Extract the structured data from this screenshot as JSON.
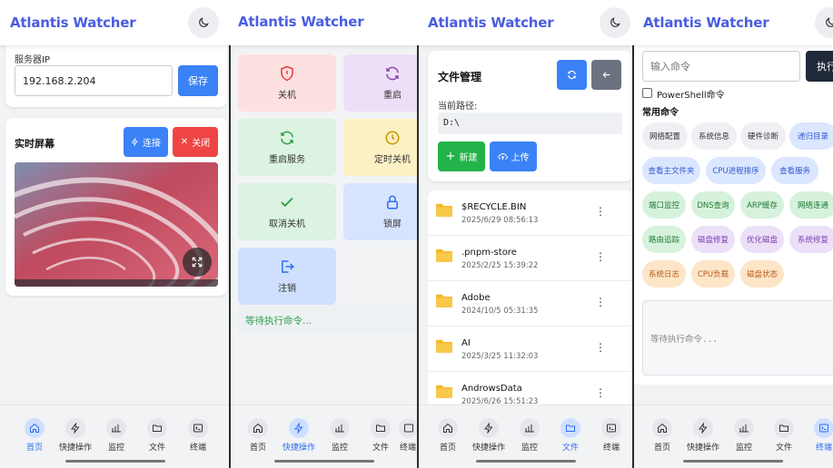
{
  "app_title": "Atlantis Watcher",
  "nav": [
    {
      "label": "首页",
      "icon": "home-icon"
    },
    {
      "label": "快捷操作",
      "icon": "bolt-icon"
    },
    {
      "label": "监控",
      "icon": "chart-icon"
    },
    {
      "label": "文件",
      "icon": "folder-icon"
    },
    {
      "label": "终端",
      "icon": "terminal-icon"
    }
  ],
  "home": {
    "server_ip_label": "服务器IP",
    "server_ip_value": "192.168.2.204",
    "save_label": "保存",
    "realtime_title": "实时屏幕",
    "connect_label": "连接",
    "close_label": "关闭"
  },
  "quick": {
    "tiles": [
      {
        "label": "关机",
        "icon": "shield-alert-icon",
        "color": "#e53935"
      },
      {
        "label": "重启",
        "icon": "refresh-icon",
        "color": "#8e44ad"
      },
      {
        "label": "重启服务",
        "icon": "refresh-icon",
        "color": "#2e9e4e"
      },
      {
        "label": "定时关机",
        "icon": "clock-icon",
        "color": "#c69500"
      },
      {
        "label": "取消关机",
        "icon": "check-icon",
        "color": "#2e9e4e"
      },
      {
        "label": "锁屏",
        "icon": "lock-icon",
        "color": "#2f6df0"
      },
      {
        "label": "注销",
        "icon": "logout-icon",
        "color": "#2f6df0"
      }
    ],
    "status": "等待执行命令..."
  },
  "files": {
    "title": "文件管理",
    "path_label": "当前路径:",
    "path_value": "D:\\",
    "new_label": "新建",
    "upload_label": "上传",
    "items": [
      {
        "name": "$RECYCLE.BIN",
        "date": "2025/6/29 08:56:13"
      },
      {
        "name": ".pnpm-store",
        "date": "2025/2/25 15:39:22"
      },
      {
        "name": "Adobe",
        "date": "2024/10/5 05:31:35"
      },
      {
        "name": "AI",
        "date": "2025/3/25 11:32:03"
      },
      {
        "name": "AndrowsData",
        "date": "2025/6/26 15:51:23"
      }
    ]
  },
  "terminal": {
    "input_placeholder": "输入命令",
    "exec_label": "执行",
    "powershell_label": "PowerShell命令",
    "common_title": "常用命令",
    "output_placeholder": "等待执行命令...",
    "commands": [
      {
        "label": "网络配置",
        "style": "g"
      },
      {
        "label": "系统信息",
        "style": "g"
      },
      {
        "label": "硬件诊断",
        "style": "g"
      },
      {
        "label": "递归目录",
        "style": "b"
      },
      {
        "label": "查看主文件夹",
        "style": "b"
      },
      {
        "label": "CPU进程排序",
        "style": "b"
      },
      {
        "label": "查看服务",
        "style": "b"
      },
      {
        "label": "端口监控",
        "style": "gr"
      },
      {
        "label": "DNS查询",
        "style": "gr"
      },
      {
        "label": "ARP缓存",
        "style": "gr"
      },
      {
        "label": "网络连通",
        "style": "gr"
      },
      {
        "label": "路由追踪",
        "style": "gr"
      },
      {
        "label": "磁盘修复",
        "style": "p"
      },
      {
        "label": "优化磁盘",
        "style": "p"
      },
      {
        "label": "系统修复",
        "style": "p"
      },
      {
        "label": "系统日志",
        "style": "o"
      },
      {
        "label": "CPU负载",
        "style": "o"
      },
      {
        "label": "磁盘状态",
        "style": "o"
      }
    ]
  }
}
